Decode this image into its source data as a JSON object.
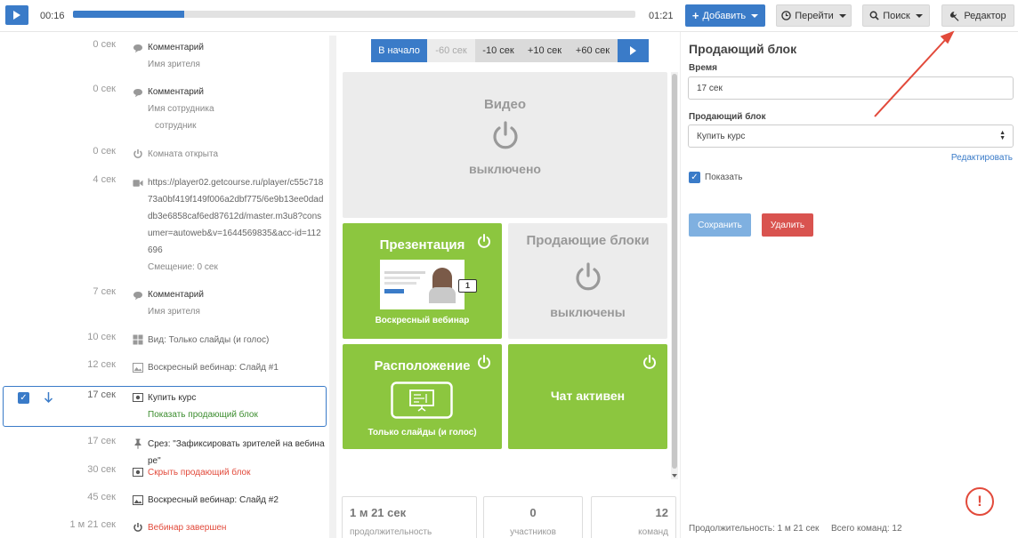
{
  "player": {
    "current_time": "00:16",
    "total_time": "01:21",
    "progress_fraction": 0.198
  },
  "toolbar": {
    "add_label": "Добавить",
    "goto_label": "Перейти",
    "search_label": "Поиск",
    "editor_label": "Редактор"
  },
  "timeline": {
    "items": [
      {
        "time": "0 сек",
        "icon": "comment-icon",
        "lines": [
          "Комментарий",
          "Имя зрителя"
        ]
      },
      {
        "time": "0 сек",
        "icon": "comment-icon",
        "lines": [
          "Комментарий",
          "Имя сотрудника",
          "сотрудник"
        ]
      },
      {
        "time": "0 сек",
        "icon": "power-icon",
        "lines": [
          "Комната открыта"
        ]
      },
      {
        "time": "4 сек",
        "icon": "video-camera-icon",
        "lines": [
          "https://player02.getcourse.ru/player/c55c71873a0bf419f149f006a2dbf775/6e9b13ee0daddb3e6858caf6ed87612d/master.m3u8?consumer=autoweb&v=1644569835&acc-id=112696",
          "Смещение: 0 сек"
        ]
      },
      {
        "time": "7 сек",
        "icon": "comment-icon",
        "lines": [
          "Комментарий",
          "Имя зрителя"
        ]
      },
      {
        "time": "10 сек",
        "icon": "layout-grid-icon",
        "lines": [
          "Вид: Только слайды (и голос)"
        ]
      },
      {
        "time": "12 сек",
        "icon": "image-icon",
        "lines": [
          "Воскресный вебинар: Слайд #1"
        ]
      },
      {
        "time": "17 сек",
        "icon": "money-icon",
        "lines": [
          "Купить курс",
          "Показать продающий блок"
        ]
      },
      {
        "time": "17 сек",
        "icon": "pin-icon",
        "lines": [
          "Срез: \"Зафиксировать зрителей на вебинаре\""
        ]
      },
      {
        "time": "30 сек",
        "icon": "money-icon",
        "lines": [
          "Скрыть продающий блок"
        ]
      },
      {
        "time": "45 сек",
        "icon": "image-icon",
        "lines": [
          "Воскресный вебинар: Слайд #2"
        ]
      },
      {
        "time": "1 м 21 сек",
        "icon": "power-icon",
        "lines": [
          "Вебинар завершен"
        ]
      }
    ]
  },
  "seek": {
    "start": "В начало",
    "m60": "-60 сек",
    "m10": "-10 сек",
    "p10": "+10 сек",
    "p60": "+60 сек"
  },
  "panels": {
    "video_title": "Видео",
    "video_status": "выключено",
    "presentation_title": "Презентация",
    "presentation_caption": "Воскресный вебинар",
    "slide_number": "1",
    "sales_title": "Продающие блоки",
    "sales_status": "выключены",
    "layout_title": "Расположение",
    "layout_caption": "Только слайды (и голос)",
    "chat_title": "Чат активен"
  },
  "stats": {
    "duration_value": "1 м 21 сек",
    "duration_label": "продолжительность",
    "participants_value": "0",
    "participants_label": "участников",
    "commands_value": "12",
    "commands_label": "команд"
  },
  "editor": {
    "title": "Продающий блок",
    "time_label": "Время",
    "time_value": "17 сек",
    "block_label": "Продающий блок",
    "block_value": "Купить курс",
    "edit_link": "Редактировать",
    "show_label": "Показать",
    "save_label": "Сохранить",
    "delete_label": "Удалить",
    "footer_duration": "Продолжительность: 1 м 21 сек",
    "footer_commands": "Всего команд: 12",
    "alert_symbol": "!"
  },
  "colors": {
    "primary": "#3a7bc8",
    "green": "#8cc63f",
    "danger": "#d9534f",
    "annotation_arrow": "#e24a3b"
  }
}
